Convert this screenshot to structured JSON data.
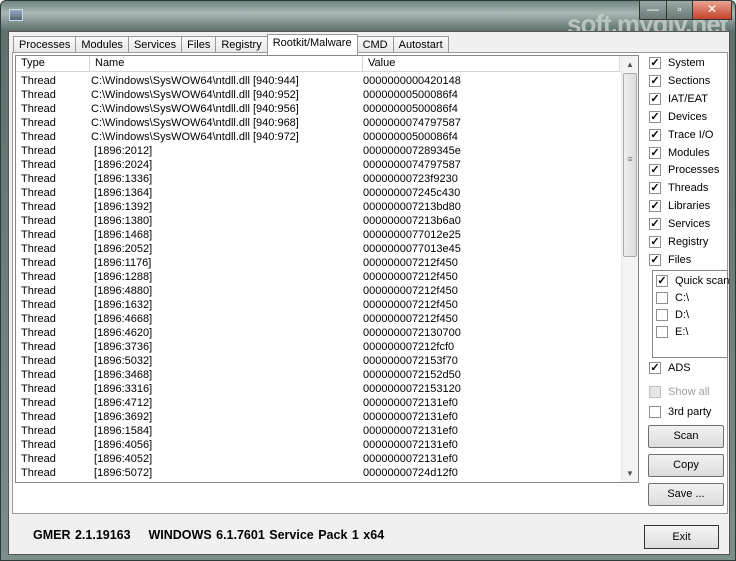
{
  "window": {
    "watermark": "soft.mydiv.net",
    "controls": {
      "minimize": "—",
      "maximize": "▫",
      "close": "✕"
    }
  },
  "tabs": [
    {
      "label": "Processes"
    },
    {
      "label": "Modules"
    },
    {
      "label": "Services"
    },
    {
      "label": "Files"
    },
    {
      "label": "Registry"
    },
    {
      "label": "Rootkit/Malware",
      "active": true
    },
    {
      "label": "CMD"
    },
    {
      "label": "Autostart"
    }
  ],
  "list": {
    "columns": [
      "Type",
      "Name",
      "Value"
    ],
    "rows": [
      [
        "Thread",
        "C:\\Windows\\SysWOW64\\ntdll.dll [940:944]",
        "0000000000420148"
      ],
      [
        "Thread",
        "C:\\Windows\\SysWOW64\\ntdll.dll [940:952]",
        "00000000500086f4"
      ],
      [
        "Thread",
        "C:\\Windows\\SysWOW64\\ntdll.dll [940:956]",
        "00000000500086f4"
      ],
      [
        "Thread",
        "C:\\Windows\\SysWOW64\\ntdll.dll [940:968]",
        "0000000074797587"
      ],
      [
        "Thread",
        "C:\\Windows\\SysWOW64\\ntdll.dll [940:972]",
        "00000000500086f4"
      ],
      [
        "Thread",
        " [1896:2012]",
        "000000007289345e"
      ],
      [
        "Thread",
        " [1896:2024]",
        "0000000074797587"
      ],
      [
        "Thread",
        " [1896:1336]",
        "00000000723f9230"
      ],
      [
        "Thread",
        " [1896:1364]",
        "000000007245c430"
      ],
      [
        "Thread",
        " [1896:1392]",
        "000000007213bd80"
      ],
      [
        "Thread",
        " [1896:1380]",
        "000000007213b6a0"
      ],
      [
        "Thread",
        " [1896:1468]",
        "0000000077012e25"
      ],
      [
        "Thread",
        " [1896:2052]",
        "0000000077013e45"
      ],
      [
        "Thread",
        " [1896:1176]",
        "000000007212f450"
      ],
      [
        "Thread",
        " [1896:1288]",
        "000000007212f450"
      ],
      [
        "Thread",
        " [1896:4880]",
        "000000007212f450"
      ],
      [
        "Thread",
        " [1896:1632]",
        "000000007212f450"
      ],
      [
        "Thread",
        " [1896:4668]",
        "000000007212f450"
      ],
      [
        "Thread",
        " [1896:4620]",
        "0000000072130700"
      ],
      [
        "Thread",
        " [1896:3736]",
        "000000007212fcf0"
      ],
      [
        "Thread",
        " [1896:5032]",
        "0000000072153f70"
      ],
      [
        "Thread",
        " [1896:3468]",
        "0000000072152d50"
      ],
      [
        "Thread",
        " [1896:3316]",
        "0000000072153120"
      ],
      [
        "Thread",
        " [1896:4712]",
        "0000000072131ef0"
      ],
      [
        "Thread",
        " [1896:3692]",
        "0000000072131ef0"
      ],
      [
        "Thread",
        " [1896:1584]",
        "0000000072131ef0"
      ],
      [
        "Thread",
        " [1896:4056]",
        "0000000072131ef0"
      ],
      [
        "Thread",
        " [1896:4052]",
        "0000000072131ef0"
      ],
      [
        "Thread",
        " [1896:5072]",
        "00000000724d12f0"
      ]
    ]
  },
  "options": [
    {
      "label": "System",
      "checked": true
    },
    {
      "label": "Sections",
      "checked": true
    },
    {
      "label": "IAT/EAT",
      "checked": true
    },
    {
      "label": "Devices",
      "checked": true
    },
    {
      "label": "Trace I/O",
      "checked": true
    },
    {
      "label": "Modules",
      "checked": true
    },
    {
      "label": "Processes",
      "checked": true
    },
    {
      "label": "Threads",
      "checked": true
    },
    {
      "label": "Libraries",
      "checked": true
    },
    {
      "label": "Services",
      "checked": true
    },
    {
      "label": "Registry",
      "checked": true
    },
    {
      "label": "Files",
      "checked": true
    }
  ],
  "files": [
    {
      "label": "Quick scan",
      "checked": true
    },
    {
      "label": "C:\\",
      "checked": false
    },
    {
      "label": "D:\\",
      "checked": false
    },
    {
      "label": "E:\\",
      "checked": false
    }
  ],
  "extra": [
    {
      "label": "ADS",
      "checked": true,
      "disabled": false
    },
    {
      "label": "Show all",
      "checked": false,
      "disabled": true
    },
    {
      "label": "3rd party",
      "checked": false,
      "disabled": false
    }
  ],
  "buttons": {
    "scan": "Scan",
    "copy": "Copy",
    "save": "Save ...",
    "exit": "Exit"
  },
  "status": "GMER 2.1.19163    WINDOWS 6.1.7601 Service Pack 1 x64"
}
